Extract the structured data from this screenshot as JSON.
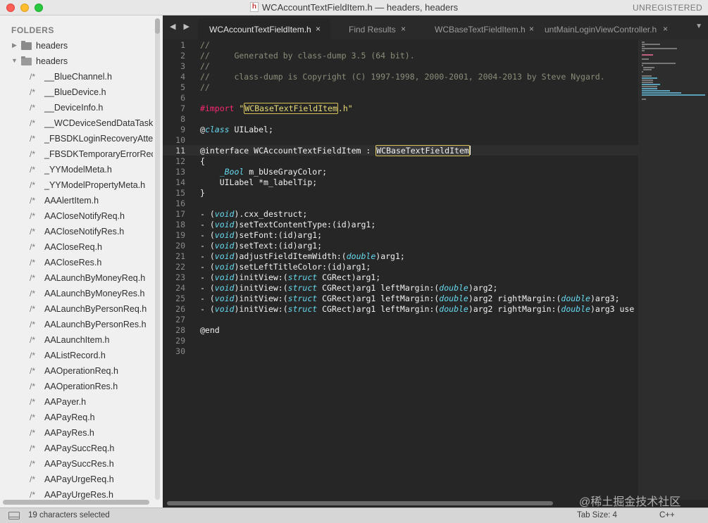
{
  "window": {
    "title": "WCAccountTextFieldItem.h — headers, headers",
    "file_icon_letter": "h",
    "license_text": "UNREGISTERED"
  },
  "sidebar": {
    "header": "FOLDERS",
    "folders": [
      {
        "label": "headers",
        "expanded": false
      },
      {
        "label": "headers",
        "expanded": true
      }
    ],
    "file_prefix": "/*",
    "files": [
      "__BlueChannel.h",
      "__BlueDevice.h",
      "__DeviceInfo.h",
      "__WCDeviceSendDataTask.h",
      "_FBSDKLoginRecoveryAttempter.h",
      "_FBSDKTemporaryErrorRecoveryAttempter.h",
      "_YYModelMeta.h",
      "_YYModelPropertyMeta.h",
      "AAAlertItem.h",
      "AACloseNotifyReq.h",
      "AACloseNotifyRes.h",
      "AACloseReq.h",
      "AACloseRes.h",
      "AALaunchByMoneyReq.h",
      "AALaunchByMoneyRes.h",
      "AALaunchByPersonReq.h",
      "AALaunchByPersonRes.h",
      "AALaunchItem.h",
      "AAListRecord.h",
      "AAOperationReq.h",
      "AAOperationRes.h",
      "AAPayer.h",
      "AAPayReq.h",
      "AAPayRes.h",
      "AAPaySuccReq.h",
      "AAPaySuccRes.h",
      "AAPayUrgeReq.h",
      "AAPayUrgeRes.h"
    ]
  },
  "tabs": [
    {
      "label": "WCAccountTextFieldItem.h",
      "active": true
    },
    {
      "label": "Find Results",
      "active": false
    },
    {
      "label": "WCBaseTextFieldItem.h",
      "active": false
    },
    {
      "label": "untMainLoginViewController.h",
      "active": false
    }
  ],
  "tab_close_glyph": "×",
  "nav_arrows": "◀ ▶",
  "tab_menu_glyph": "▼",
  "editor": {
    "line_numbers": [
      "1",
      "2",
      "3",
      "4",
      "5",
      "6",
      "7",
      "8",
      "9",
      "10",
      "11",
      "12",
      "13",
      "14",
      "15",
      "16",
      "17",
      "18",
      "19",
      "20",
      "21",
      "22",
      "23",
      "24",
      "25",
      "26",
      "27",
      "28",
      "29",
      "30"
    ],
    "current_line": 11,
    "code": {
      "l1": "//",
      "l2": "//     Generated by class-dump 3.5 (64 bit).",
      "l3": "//",
      "l4": "//     class-dump is Copyright (C) 1997-1998, 2000-2001, 2004-2013 by Steve Nygard.",
      "l5": "//",
      "l7_directive": "#import",
      "l7_quote_open": "\"",
      "l7_highlight": "WCBaseTextFieldItem",
      "l7_rest": ".h\"",
      "l9_at": "@",
      "l9_class": "class",
      "l9_rest": " UILabel;",
      "l11_decl": "@interface WCAccountTextFieldItem : ",
      "l11_highlight": "WCBaseTextFieldItem",
      "l12": "{",
      "l13_type": "_Bool",
      "l13_rest": " m_bUseGrayColor;",
      "l14": "    UILabel *m_labelTip;",
      "l15": "}",
      "l17": "- (void).cxx_destruct;",
      "l18": "- (void)setTextContentType:(id)arg1;",
      "l19": "- (void)setFont:(id)arg1;",
      "l20": "- (void)setText:(id)arg1;",
      "l21": "- (void)adjustFieldItemWidth:(double)arg1;",
      "l22": "- (void)setLeftTitleColor:(id)arg1;",
      "l23": "- (void)initView:(struct CGRect)arg1;",
      "l24": "- (void)initView:(struct CGRect)arg1 leftMargin:(double)arg2;",
      "l25": "- (void)initView:(struct CGRect)arg1 leftMargin:(double)arg2 rightMargin:(double)arg3;",
      "l26": "- (void)initView:(struct CGRect)arg1 leftMargin:(double)arg2 rightMargin:(double)arg3 use",
      "l28": "@end"
    }
  },
  "status": {
    "selection": "19 characters selected",
    "tab_size": "Tab Size: 4",
    "syntax": "C++"
  },
  "watermark": "@稀土掘金技术社区",
  "colors": {
    "editor_bg": "#262626",
    "comment": "#8c8c7a",
    "keyword": "#f92672",
    "string": "#e6db74",
    "type": "#66d9ef"
  }
}
